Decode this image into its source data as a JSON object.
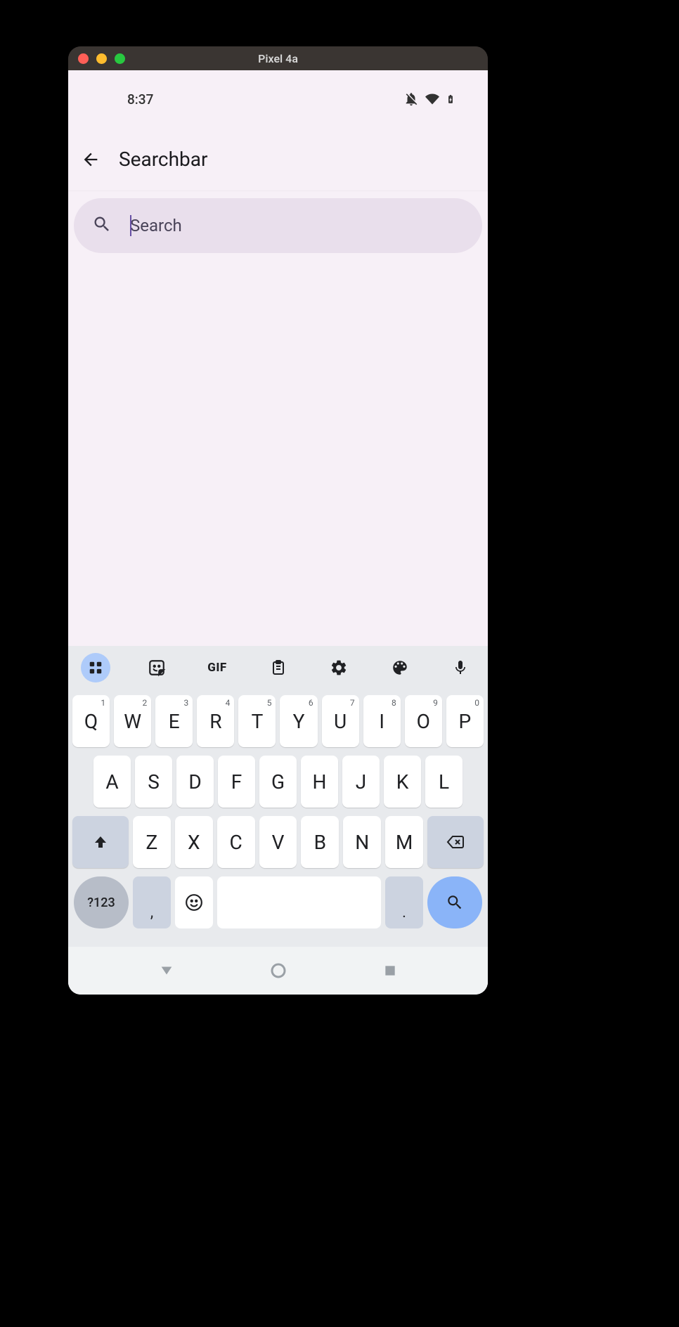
{
  "window": {
    "title": "Pixel 4a"
  },
  "statusbar": {
    "time": "8:37"
  },
  "appbar": {
    "title": "Searchbar"
  },
  "searchbar": {
    "placeholder": "Search",
    "value": ""
  },
  "keyboard": {
    "toolbar": {
      "gif_label": "GIF"
    },
    "row1": [
      {
        "label": "Q",
        "hint": "1"
      },
      {
        "label": "W",
        "hint": "2"
      },
      {
        "label": "E",
        "hint": "3"
      },
      {
        "label": "R",
        "hint": "4"
      },
      {
        "label": "T",
        "hint": "5"
      },
      {
        "label": "Y",
        "hint": "6"
      },
      {
        "label": "U",
        "hint": "7"
      },
      {
        "label": "I",
        "hint": "8"
      },
      {
        "label": "O",
        "hint": "9"
      },
      {
        "label": "P",
        "hint": "0"
      }
    ],
    "row2": [
      "A",
      "S",
      "D",
      "F",
      "G",
      "H",
      "J",
      "K",
      "L"
    ],
    "row3": [
      "Z",
      "X",
      "C",
      "V",
      "B",
      "N",
      "M"
    ],
    "symbols_label": "?123",
    "comma": ",",
    "period": "."
  }
}
